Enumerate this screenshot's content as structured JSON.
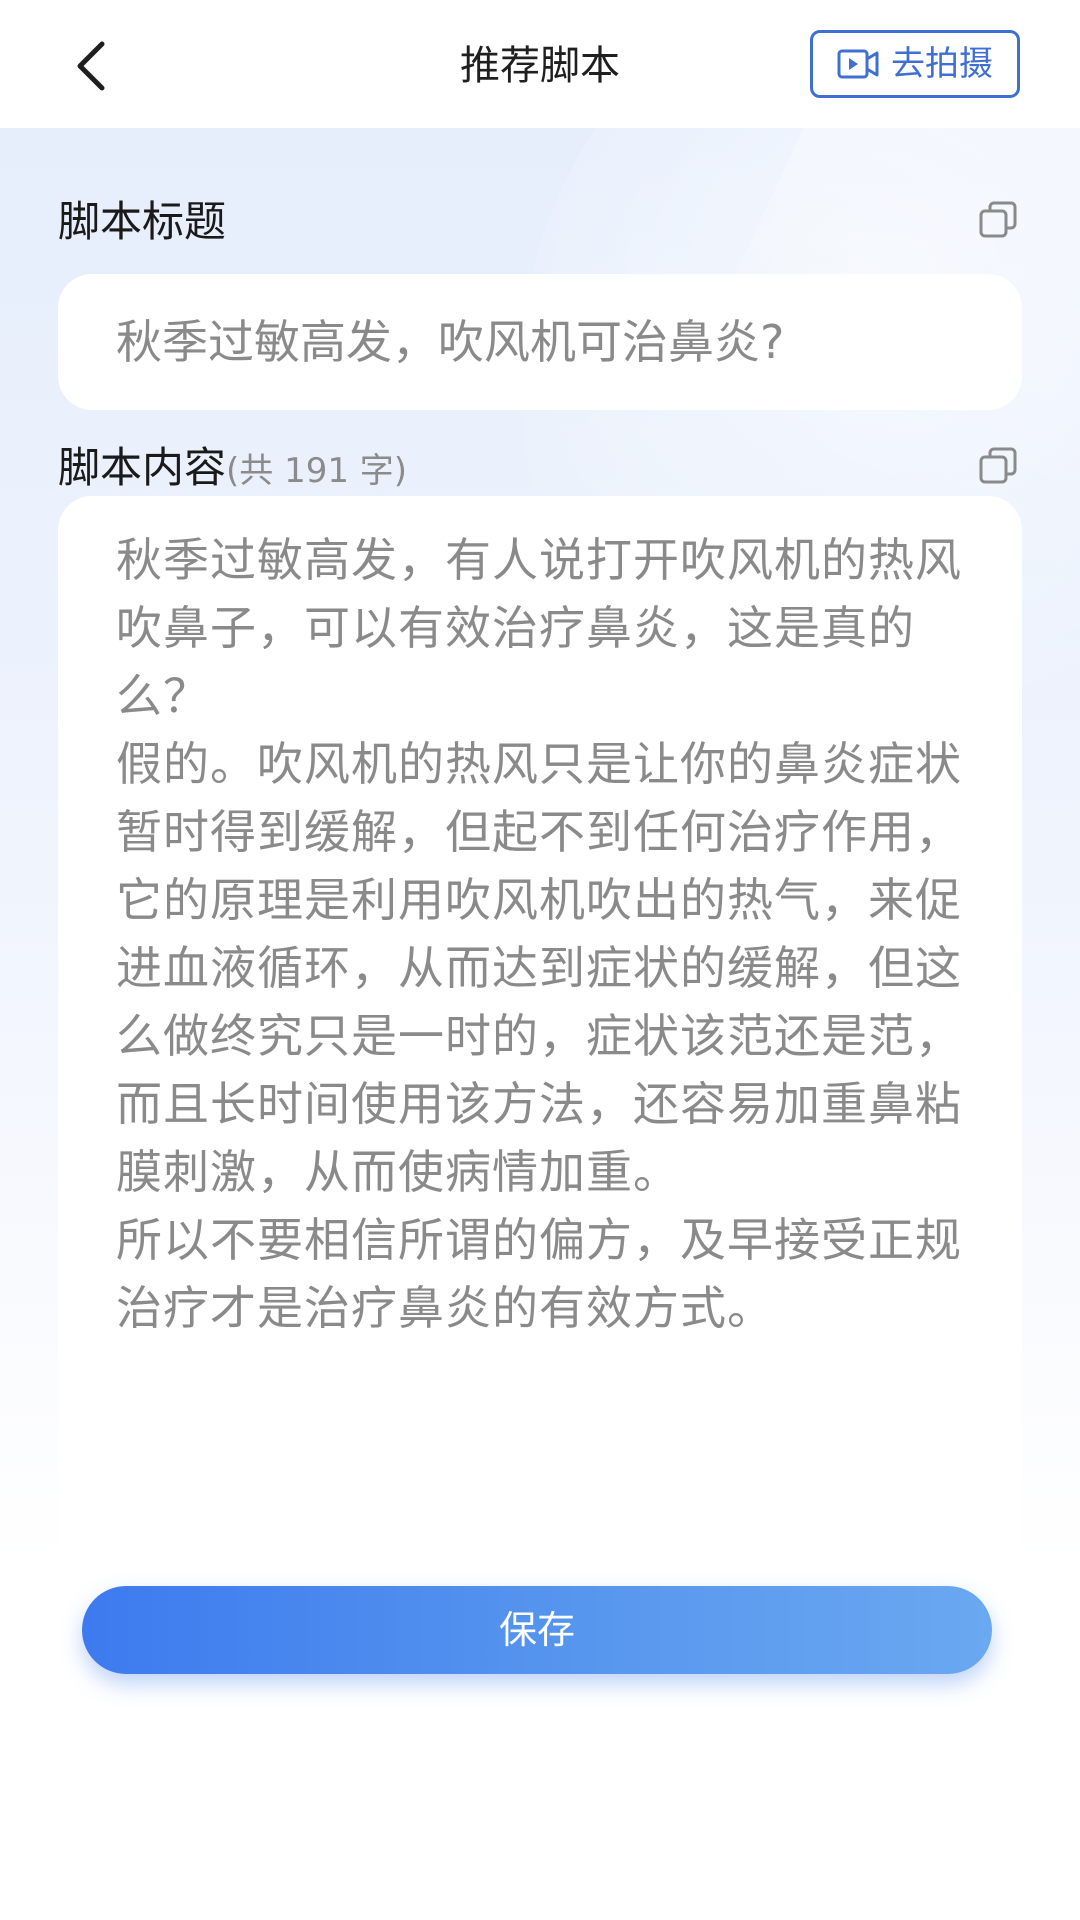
{
  "header": {
    "title": "推荐脚本",
    "shoot_label": "去拍摄"
  },
  "script_title": {
    "label": "脚本标题",
    "value": "秋季过敏高发，吹风机可治鼻炎?"
  },
  "script_content": {
    "label": "脚本内容",
    "count": "(共 191 字)",
    "paragraphs": [
      "秋季过敏高发，有人说打开吹风机的热风吹鼻子，可以有效治疗鼻炎，这是真的么？",
      "假的。吹风机的热风只是让你的鼻炎症状暂时得到缓解，但起不到任何治疗作用，它的原理是利用吹风机吹出的热气，来促进血液循环，从而达到症状的缓解，但这么做终究只是一时的，症状该范还是范，而且长时间使用该方法，还容易加重鼻粘膜刺激，从而使病情加重。",
      "所以不要相信所谓的偏方，及早接受正规治疗才是治疗鼻炎的有效方式。"
    ]
  },
  "save_label": "保存",
  "colors": {
    "accent": "#3f6fd3",
    "button_gradient_start": "#3d7aef",
    "button_gradient_end": "#6aa8f1",
    "placeholder_text": "#8a8a8a"
  },
  "icons": {
    "back": "chevron-left-icon",
    "shoot": "video-camera-icon",
    "copy": "copy-icon"
  }
}
